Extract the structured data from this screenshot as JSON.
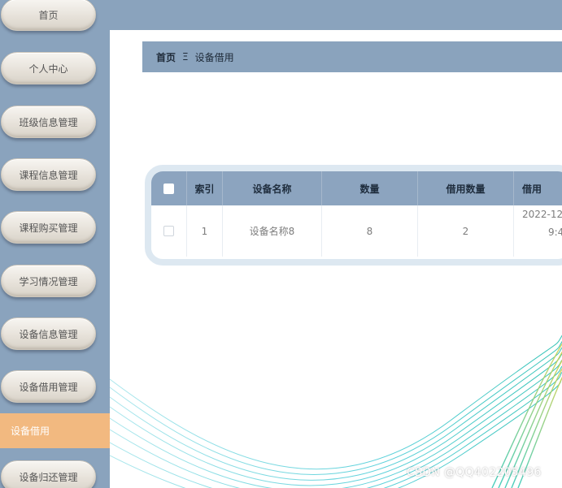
{
  "sidebar": {
    "items": [
      {
        "label": "首页"
      },
      {
        "label": "个人中心"
      },
      {
        "label": "班级信息管理"
      },
      {
        "label": "课程信息管理"
      },
      {
        "label": "课程购买管理"
      },
      {
        "label": "学习情况管理"
      },
      {
        "label": "设备信息管理"
      },
      {
        "label": "设备借用管理"
      },
      {
        "label": "设备借用",
        "active": true
      },
      {
        "label": "设备归还管理"
      }
    ]
  },
  "breadcrumb": {
    "home": "首页",
    "separator": "Ξ",
    "current": "设备借用"
  },
  "table": {
    "columns": [
      "索引",
      "设备名称",
      "数量",
      "借用数量",
      "借用"
    ],
    "rows": [
      {
        "index": "1",
        "name": "设备名称8",
        "quantity": "8",
        "borrowed": "2",
        "date_line1": "2022-12",
        "date_line2": "9:4"
      }
    ]
  },
  "watermark": "CSDN @QQ402205496",
  "colors": {
    "sidebar_bg": "#8aa3bd",
    "active_item": "#f2b980",
    "table_header": "#8ca4bf"
  }
}
